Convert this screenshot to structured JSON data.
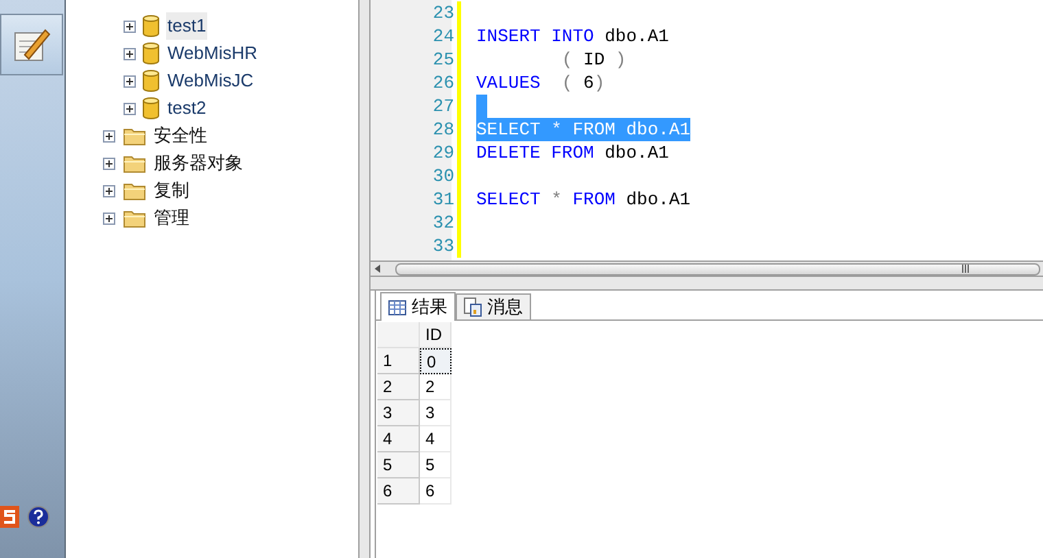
{
  "tree": {
    "items": [
      {
        "label": "test1",
        "kind": "database",
        "expanded": false,
        "selected": true
      },
      {
        "label": "WebMisHR",
        "kind": "database",
        "expanded": false,
        "selected": false
      },
      {
        "label": "WebMisJC",
        "kind": "database",
        "expanded": false,
        "selected": false
      },
      {
        "label": "test2",
        "kind": "database",
        "expanded": false,
        "selected": false
      },
      {
        "label": "安全性",
        "kind": "folder",
        "expanded": false,
        "selected": false
      },
      {
        "label": "服务器对象",
        "kind": "folder",
        "expanded": false,
        "selected": false
      },
      {
        "label": "复制",
        "kind": "folder",
        "expanded": false,
        "selected": false
      },
      {
        "label": "管理",
        "kind": "folder",
        "expanded": false,
        "selected": false
      }
    ]
  },
  "editor": {
    "lines": [
      {
        "number": "23",
        "selected": false
      },
      {
        "number": "24",
        "selected": false,
        "tokens": [
          {
            "text": "INSERT INTO",
            "kind": "keyword"
          },
          {
            "text": " dbo.A1",
            "kind": "name"
          }
        ]
      },
      {
        "number": "25",
        "selected": false,
        "tokens": [
          {
            "text": "        ( ",
            "kind": "punct"
          },
          {
            "text": "ID",
            "kind": "name"
          },
          {
            "text": " )",
            "kind": "punct"
          }
        ]
      },
      {
        "number": "26",
        "selected": false,
        "tokens": [
          {
            "text": "VALUES",
            "kind": "keyword"
          },
          {
            "text": "  ( ",
            "kind": "punct"
          },
          {
            "text": "6",
            "kind": "name"
          },
          {
            "text": ")",
            "kind": "punct"
          }
        ]
      },
      {
        "number": "27",
        "selected": true
      },
      {
        "number": "28",
        "selected": true,
        "tokens": [
          {
            "text": "SELECT",
            "kind": "keyword"
          },
          {
            "text": " * ",
            "kind": "punct"
          },
          {
            "text": "FROM",
            "kind": "keyword"
          },
          {
            "text": " dbo.A1",
            "kind": "name"
          }
        ]
      },
      {
        "number": "29",
        "selected": false,
        "tokens": [
          {
            "text": "DELETE FROM",
            "kind": "keyword"
          },
          {
            "text": " dbo.A1",
            "kind": "name"
          }
        ]
      },
      {
        "number": "30",
        "selected": false
      },
      {
        "number": "31",
        "selected": false,
        "tokens": [
          {
            "text": "SELECT",
            "kind": "keyword"
          },
          {
            "text": " * ",
            "kind": "punct"
          },
          {
            "text": "FROM",
            "kind": "keyword"
          },
          {
            "text": " dbo.A1",
            "kind": "name"
          }
        ]
      },
      {
        "number": "32",
        "selected": false
      },
      {
        "number": "33",
        "selected": false
      }
    ]
  },
  "results": {
    "tabs": [
      {
        "label": "结果",
        "kind": "grid",
        "selected": true
      },
      {
        "label": "消息",
        "kind": "messages",
        "selected": false
      }
    ],
    "columns": [
      "ID"
    ],
    "rows": [
      {
        "number": "1",
        "cells": [
          "0"
        ],
        "selected": true
      },
      {
        "number": "2",
        "cells": [
          "2"
        ],
        "selected": false
      },
      {
        "number": "3",
        "cells": [
          "3"
        ],
        "selected": false
      },
      {
        "number": "4",
        "cells": [
          "4"
        ],
        "selected": false
      },
      {
        "number": "5",
        "cells": [
          "5"
        ],
        "selected": false
      },
      {
        "number": "6",
        "cells": [
          "6"
        ],
        "selected": false
      }
    ]
  }
}
